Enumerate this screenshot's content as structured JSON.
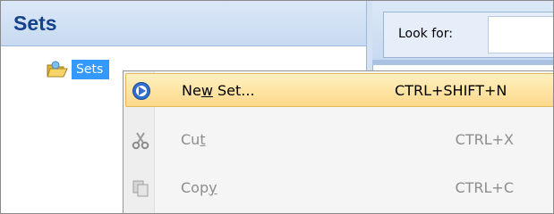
{
  "sets_panel": {
    "title": "Sets",
    "tree": [
      {
        "label": "Sets",
        "icon": "folder-open-icon",
        "selected": true
      }
    ]
  },
  "find_bar": {
    "look_for_label": "Look for:",
    "look_for_value": ""
  },
  "context_menu": {
    "items": [
      {
        "label_pre": "Ne",
        "label_acc": "w",
        "label_post": " Set...",
        "shortcut": "CTRL+SHIFT+N",
        "icon": "new-set-icon",
        "enabled": true,
        "highlighted": true
      },
      {
        "label_pre": "Cu",
        "label_acc": "t",
        "label_post": "",
        "shortcut": "CTRL+X",
        "icon": "scissors-icon",
        "enabled": false,
        "highlighted": false
      },
      {
        "label_pre": "Cop",
        "label_acc": "y",
        "label_post": "",
        "shortcut": "CTRL+C",
        "icon": "copy-icon",
        "enabled": false,
        "highlighted": false
      }
    ]
  },
  "colors": {
    "header_text": "#15428b",
    "selection": "#3399ff",
    "menu_highlight": "#fcd88a",
    "disabled_text": "#8d8d8d"
  }
}
